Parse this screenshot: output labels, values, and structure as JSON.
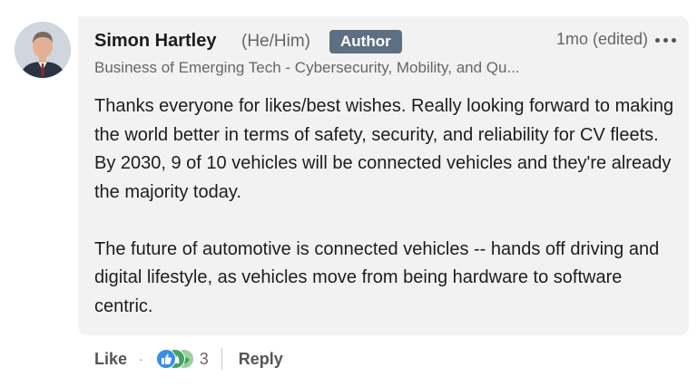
{
  "comment": {
    "author_name": "Simon Hartley",
    "pronouns": "(He/Him)",
    "badge": "Author",
    "timestamp": "1mo (edited)",
    "headline": "Business of Emerging Tech - Cybersecurity, Mobility, and Qu...",
    "paragraphs": [
      "Thanks everyone for likes/best wishes. Really looking forward to making the world better in terms of safety, security, and reliability for CV fleets. By 2030, 9 of 10 vehicles will be connected vehicles and they're already the majority today.",
      "The future of automotive is connected vehicles -- hands off driving and digital lifestyle, as vehicles move from being hardware to software centric."
    ]
  },
  "actions": {
    "like_label": "Like",
    "separator": "·",
    "reaction_count": "3",
    "reply_label": "Reply",
    "reaction_icons": [
      "like-icon",
      "celebrate-icon",
      "support-icon"
    ]
  },
  "colors": {
    "bubble_bg": "#f2f2f2",
    "badge_bg": "#5d6f82",
    "like_blue": "#378fe9",
    "celebrate_green": "#44a263",
    "text_primary": "#1d1d1d",
    "text_secondary": "#666666"
  }
}
